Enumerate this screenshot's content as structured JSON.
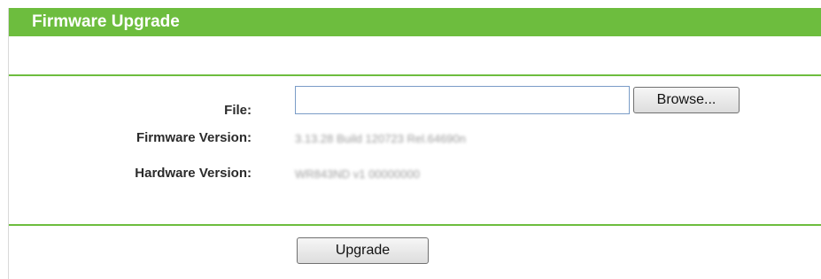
{
  "header": {
    "title": "Firmware Upgrade",
    "accent_color": "#6dbd3e"
  },
  "form": {
    "file_label": "File:",
    "file_value": "",
    "browse_label": "Browse...",
    "firmware_label": "Firmware Version:",
    "firmware_value": "3.13.28 Build 120723 Rel.64690n",
    "hardware_label": "Hardware Version:",
    "hardware_value": "WR843ND v1 00000000",
    "upgrade_label": "Upgrade"
  }
}
